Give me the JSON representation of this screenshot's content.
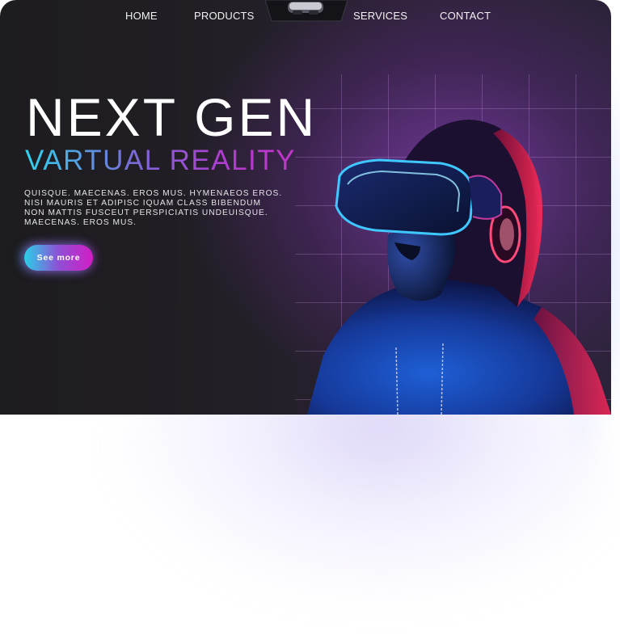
{
  "nav": {
    "items": [
      {
        "label": "HOME"
      },
      {
        "label": "PRODUCTS"
      },
      {
        "label": "SERVICES"
      },
      {
        "label": "CONTACT"
      }
    ]
  },
  "hero": {
    "headline": "NEXT GEN",
    "subheadline": "VARTUAL REALITY",
    "body_lines": [
      "QUISQUE. MAECENAS. EROS MUS. HYMENAEOS EROS.",
      "NISI MAURIS ET ADIPISC IQUAM CLASS BIBENDUM",
      "NON MATTIS FUSCEUT PERSPICIATIS UNDEUISQUE.",
      "MAECENAS. EROS MUS."
    ],
    "cta_label": "See more"
  },
  "colors": {
    "background_dark": "#1d1c1f",
    "accent_purple": "#7c3ca8",
    "gradient_cyan": "#2fd2ee",
    "gradient_magenta": "#d21ec4",
    "text_white": "#ffffff"
  },
  "icons": {
    "nav_center": "vr-headset-icon"
  }
}
